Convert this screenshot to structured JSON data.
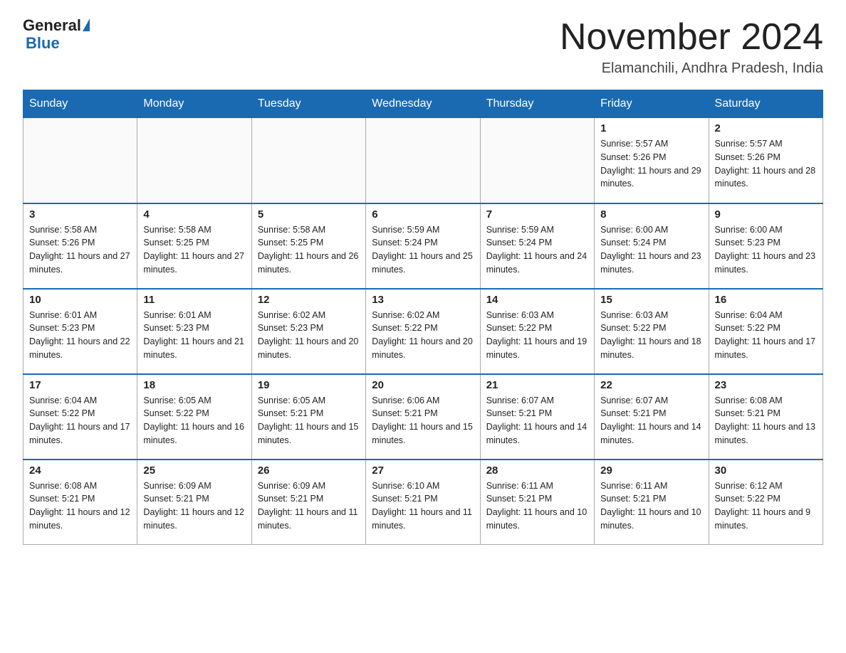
{
  "header": {
    "logo_general": "General",
    "logo_blue": "Blue",
    "month_title": "November 2024",
    "location": "Elamanchili, Andhra Pradesh, India"
  },
  "days_of_week": [
    "Sunday",
    "Monday",
    "Tuesday",
    "Wednesday",
    "Thursday",
    "Friday",
    "Saturday"
  ],
  "weeks": [
    [
      {
        "day": "",
        "sunrise": "",
        "sunset": "",
        "daylight": "",
        "empty": true
      },
      {
        "day": "",
        "sunrise": "",
        "sunset": "",
        "daylight": "",
        "empty": true
      },
      {
        "day": "",
        "sunrise": "",
        "sunset": "",
        "daylight": "",
        "empty": true
      },
      {
        "day": "",
        "sunrise": "",
        "sunset": "",
        "daylight": "",
        "empty": true
      },
      {
        "day": "",
        "sunrise": "",
        "sunset": "",
        "daylight": "",
        "empty": true
      },
      {
        "day": "1",
        "sunrise": "Sunrise: 5:57 AM",
        "sunset": "Sunset: 5:26 PM",
        "daylight": "Daylight: 11 hours and 29 minutes.",
        "empty": false
      },
      {
        "day": "2",
        "sunrise": "Sunrise: 5:57 AM",
        "sunset": "Sunset: 5:26 PM",
        "daylight": "Daylight: 11 hours and 28 minutes.",
        "empty": false
      }
    ],
    [
      {
        "day": "3",
        "sunrise": "Sunrise: 5:58 AM",
        "sunset": "Sunset: 5:26 PM",
        "daylight": "Daylight: 11 hours and 27 minutes.",
        "empty": false
      },
      {
        "day": "4",
        "sunrise": "Sunrise: 5:58 AM",
        "sunset": "Sunset: 5:25 PM",
        "daylight": "Daylight: 11 hours and 27 minutes.",
        "empty": false
      },
      {
        "day": "5",
        "sunrise": "Sunrise: 5:58 AM",
        "sunset": "Sunset: 5:25 PM",
        "daylight": "Daylight: 11 hours and 26 minutes.",
        "empty": false
      },
      {
        "day": "6",
        "sunrise": "Sunrise: 5:59 AM",
        "sunset": "Sunset: 5:24 PM",
        "daylight": "Daylight: 11 hours and 25 minutes.",
        "empty": false
      },
      {
        "day": "7",
        "sunrise": "Sunrise: 5:59 AM",
        "sunset": "Sunset: 5:24 PM",
        "daylight": "Daylight: 11 hours and 24 minutes.",
        "empty": false
      },
      {
        "day": "8",
        "sunrise": "Sunrise: 6:00 AM",
        "sunset": "Sunset: 5:24 PM",
        "daylight": "Daylight: 11 hours and 23 minutes.",
        "empty": false
      },
      {
        "day": "9",
        "sunrise": "Sunrise: 6:00 AM",
        "sunset": "Sunset: 5:23 PM",
        "daylight": "Daylight: 11 hours and 23 minutes.",
        "empty": false
      }
    ],
    [
      {
        "day": "10",
        "sunrise": "Sunrise: 6:01 AM",
        "sunset": "Sunset: 5:23 PM",
        "daylight": "Daylight: 11 hours and 22 minutes.",
        "empty": false
      },
      {
        "day": "11",
        "sunrise": "Sunrise: 6:01 AM",
        "sunset": "Sunset: 5:23 PM",
        "daylight": "Daylight: 11 hours and 21 minutes.",
        "empty": false
      },
      {
        "day": "12",
        "sunrise": "Sunrise: 6:02 AM",
        "sunset": "Sunset: 5:23 PM",
        "daylight": "Daylight: 11 hours and 20 minutes.",
        "empty": false
      },
      {
        "day": "13",
        "sunrise": "Sunrise: 6:02 AM",
        "sunset": "Sunset: 5:22 PM",
        "daylight": "Daylight: 11 hours and 20 minutes.",
        "empty": false
      },
      {
        "day": "14",
        "sunrise": "Sunrise: 6:03 AM",
        "sunset": "Sunset: 5:22 PM",
        "daylight": "Daylight: 11 hours and 19 minutes.",
        "empty": false
      },
      {
        "day": "15",
        "sunrise": "Sunrise: 6:03 AM",
        "sunset": "Sunset: 5:22 PM",
        "daylight": "Daylight: 11 hours and 18 minutes.",
        "empty": false
      },
      {
        "day": "16",
        "sunrise": "Sunrise: 6:04 AM",
        "sunset": "Sunset: 5:22 PM",
        "daylight": "Daylight: 11 hours and 17 minutes.",
        "empty": false
      }
    ],
    [
      {
        "day": "17",
        "sunrise": "Sunrise: 6:04 AM",
        "sunset": "Sunset: 5:22 PM",
        "daylight": "Daylight: 11 hours and 17 minutes.",
        "empty": false
      },
      {
        "day": "18",
        "sunrise": "Sunrise: 6:05 AM",
        "sunset": "Sunset: 5:22 PM",
        "daylight": "Daylight: 11 hours and 16 minutes.",
        "empty": false
      },
      {
        "day": "19",
        "sunrise": "Sunrise: 6:05 AM",
        "sunset": "Sunset: 5:21 PM",
        "daylight": "Daylight: 11 hours and 15 minutes.",
        "empty": false
      },
      {
        "day": "20",
        "sunrise": "Sunrise: 6:06 AM",
        "sunset": "Sunset: 5:21 PM",
        "daylight": "Daylight: 11 hours and 15 minutes.",
        "empty": false
      },
      {
        "day": "21",
        "sunrise": "Sunrise: 6:07 AM",
        "sunset": "Sunset: 5:21 PM",
        "daylight": "Daylight: 11 hours and 14 minutes.",
        "empty": false
      },
      {
        "day": "22",
        "sunrise": "Sunrise: 6:07 AM",
        "sunset": "Sunset: 5:21 PM",
        "daylight": "Daylight: 11 hours and 14 minutes.",
        "empty": false
      },
      {
        "day": "23",
        "sunrise": "Sunrise: 6:08 AM",
        "sunset": "Sunset: 5:21 PM",
        "daylight": "Daylight: 11 hours and 13 minutes.",
        "empty": false
      }
    ],
    [
      {
        "day": "24",
        "sunrise": "Sunrise: 6:08 AM",
        "sunset": "Sunset: 5:21 PM",
        "daylight": "Daylight: 11 hours and 12 minutes.",
        "empty": false
      },
      {
        "day": "25",
        "sunrise": "Sunrise: 6:09 AM",
        "sunset": "Sunset: 5:21 PM",
        "daylight": "Daylight: 11 hours and 12 minutes.",
        "empty": false
      },
      {
        "day": "26",
        "sunrise": "Sunrise: 6:09 AM",
        "sunset": "Sunset: 5:21 PM",
        "daylight": "Daylight: 11 hours and 11 minutes.",
        "empty": false
      },
      {
        "day": "27",
        "sunrise": "Sunrise: 6:10 AM",
        "sunset": "Sunset: 5:21 PM",
        "daylight": "Daylight: 11 hours and 11 minutes.",
        "empty": false
      },
      {
        "day": "28",
        "sunrise": "Sunrise: 6:11 AM",
        "sunset": "Sunset: 5:21 PM",
        "daylight": "Daylight: 11 hours and 10 minutes.",
        "empty": false
      },
      {
        "day": "29",
        "sunrise": "Sunrise: 6:11 AM",
        "sunset": "Sunset: 5:21 PM",
        "daylight": "Daylight: 11 hours and 10 minutes.",
        "empty": false
      },
      {
        "day": "30",
        "sunrise": "Sunrise: 6:12 AM",
        "sunset": "Sunset: 5:22 PM",
        "daylight": "Daylight: 11 hours and 9 minutes.",
        "empty": false
      }
    ]
  ]
}
